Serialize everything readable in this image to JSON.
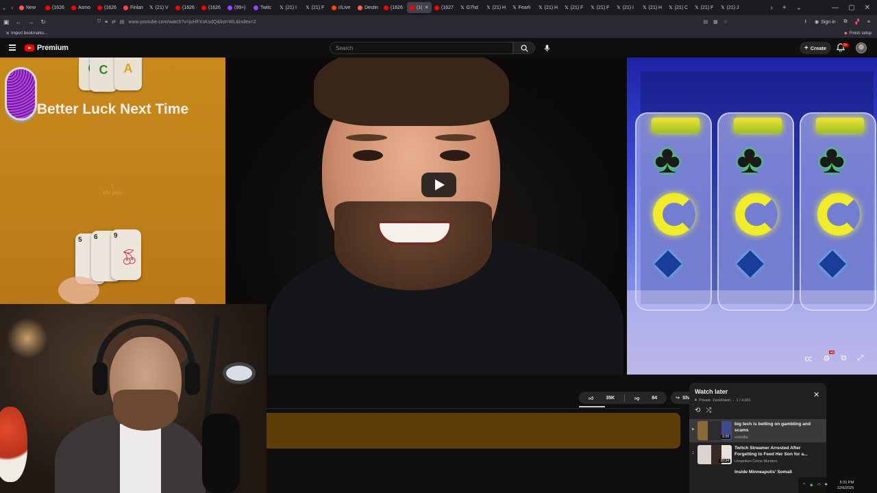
{
  "browser": {
    "tabs": [
      {
        "label": "New",
        "icon_color": "#ff5555"
      },
      {
        "label": "(1626",
        "icon_color": "#ff0000"
      },
      {
        "label": "Asmo",
        "icon_color": "#ff0000"
      },
      {
        "label": "(1626",
        "icon_color": "#ff0000"
      },
      {
        "label": "Finlan",
        "icon_color": "#ff4444"
      },
      {
        "label": "(21) V",
        "icon": "x"
      },
      {
        "label": "(1626",
        "icon_color": "#ff0000"
      },
      {
        "label": "(1626",
        "icon_color": "#ff0000"
      },
      {
        "label": "(99+)",
        "icon_color": "#9146ff"
      },
      {
        "label": "Twitc",
        "icon_color": "#9146ff"
      },
      {
        "label": "(21) I",
        "icon": "x"
      },
      {
        "label": "(21) F",
        "icon": "x"
      },
      {
        "label": "r/Live",
        "icon_color": "#ff4500"
      },
      {
        "label": "Destin",
        "icon_color": "#ff6644"
      },
      {
        "label": "(1626",
        "icon_color": "#ff0000"
      },
      {
        "label": "(1(",
        "icon_color": "#ff0000",
        "active": true
      },
      {
        "label": "(1627",
        "icon_color": "#ff0000"
      },
      {
        "label": "G7hd",
        "icon": "x"
      },
      {
        "label": "(21) H",
        "icon": "x"
      },
      {
        "label": "Fearli",
        "icon": "x"
      },
      {
        "label": "(21) H",
        "icon": "x"
      },
      {
        "label": "(21) F",
        "icon": "x"
      },
      {
        "label": "(21) F",
        "icon": "x"
      },
      {
        "label": "(21) I",
        "icon": "x"
      },
      {
        "label": "(21) H",
        "icon": "x"
      },
      {
        "label": "(21) C",
        "icon": "x"
      },
      {
        "label": "(21) F",
        "icon": "x"
      },
      {
        "label": "(21) J",
        "icon": "x"
      }
    ],
    "url": "www.youtube.com/watch?v=juHFXsKsdQ&list=WL&index=2",
    "sign_in": "Sign in",
    "import_bookmarks": "Import bookmarks...",
    "finish_setup": "Finish setup"
  },
  "youtube": {
    "logo_text": "Premium",
    "search_placeholder": "Search",
    "create_label": "Create",
    "notification_badge": "9+"
  },
  "video": {
    "left_panel": {
      "heading": "Better Luck Next Time",
      "faint_counter": "1",
      "faint_caption": "My play",
      "top_tiles": [
        "C",
        "A"
      ],
      "bottom_tiles": [
        "5",
        "6",
        "9"
      ]
    },
    "brand_colors": {
      "accent": "#ff0000",
      "left_panel_bg": "#c88a1d",
      "right_panel_bg": "#3a49d8"
    }
  },
  "actions": {
    "likes": "35K",
    "dislikes": "84",
    "share": "Share"
  },
  "playlist": {
    "title": "Watch later",
    "privacy": "Private",
    "owner": "ZackRawrr",
    "position": "1 / 4,991",
    "items": [
      {
        "index": "▶",
        "title": "big tech is betting on gambling and scams",
        "channel": "voidzilla",
        "duration": "",
        "current": true
      },
      {
        "index": "2",
        "title": "Twitch Streamer Arrested After Forgetting to Feed Her Son for a...",
        "channel": "Unspoken Crime Murders",
        "duration": "20:34",
        "current": false
      },
      {
        "index": "3",
        "title": "Inside Minneapolis' Somali",
        "channel": "",
        "duration": "",
        "current": false
      }
    ],
    "thumb_duration_1": "6:39"
  },
  "taskbar": {
    "time": "5:31 PM",
    "date": "12/6/2025"
  }
}
